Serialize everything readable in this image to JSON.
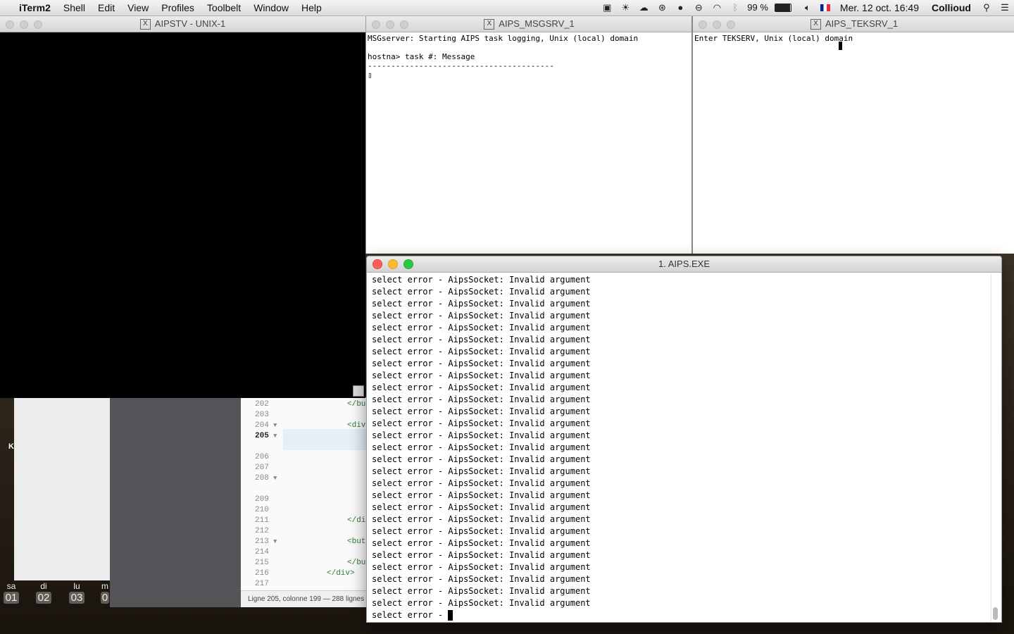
{
  "menubar": {
    "app": "iTerm2",
    "items": [
      "Shell",
      "Edit",
      "View",
      "Profiles",
      "Toolbelt",
      "Window",
      "Help"
    ],
    "battery": "99 %",
    "datetime": "Mer. 12 oct.  16:49",
    "user": "Collioud"
  },
  "windows": {
    "aipstv": {
      "title": "AIPSTV - UNIX-1"
    },
    "msgsrv": {
      "title": "AIPS_MSGSRV_1",
      "lines": [
        "MSGserver: Starting AIPS task logging, Unix (local) domain",
        "",
        "hostna> task #: Message",
        "----------------------------------------",
        "▯"
      ]
    },
    "teksrv": {
      "title": "AIPS_TEKSRV_1",
      "line": "Enter TEKSERV, Unix (local) domain"
    },
    "iterm": {
      "title": "1. AIPS.EXE",
      "repeated_line": "select error - AipsSocket: Invalid argument",
      "repeat_count": 28,
      "last_line": "select error - "
    }
  },
  "editor": {
    "lines": [
      {
        "num": "202",
        "code": "</bu"
      },
      {
        "num": "203",
        "code": ""
      },
      {
        "num": "204",
        "code": "<div",
        "fold": true
      },
      {
        "num": "205",
        "code": "",
        "fold": true,
        "current": true
      },
      {
        "num": "206",
        "code": ""
      },
      {
        "num": "207",
        "code": ""
      },
      {
        "num": "208",
        "code": "",
        "fold": true
      },
      {
        "num": "209",
        "code": ""
      },
      {
        "num": "210",
        "code": ""
      },
      {
        "num": "211",
        "code": "</di"
      },
      {
        "num": "212",
        "code": ""
      },
      {
        "num": "213",
        "code": "<but",
        "fold": true
      },
      {
        "num": "214",
        "code": ""
      },
      {
        "num": "215",
        "code": "</bu"
      },
      {
        "num": "216",
        "code": "</div>"
      },
      {
        "num": "217",
        "code": ""
      }
    ],
    "status": "Ligne 205, colonne 199 — 288 lignes"
  },
  "calendar": {
    "days": [
      {
        "name": "sa",
        "num": "01"
      },
      {
        "name": "di",
        "num": "02"
      },
      {
        "name": "lu",
        "num": "03"
      },
      {
        "name": "m",
        "num": "0"
      }
    ]
  }
}
